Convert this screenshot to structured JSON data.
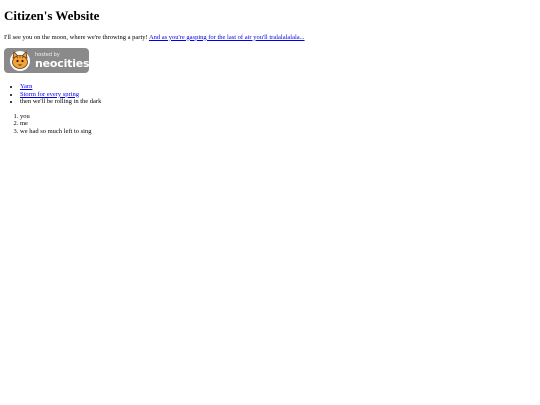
{
  "page": {
    "title": "Citizen's Website",
    "intro_text": "I'll see you on the moon, where we're throwing a party! ",
    "intro_link": "And as you're gasping for the last of air you'll tralalalalala...",
    "badge": {
      "small_text": "hosted by",
      "big_text": "neocities",
      "icon": "neocities-cat-icon"
    },
    "unordered_list": [
      "Yarn",
      "Storm for every spring",
      "then we'll be rolling in the dark"
    ],
    "ordered_list": [
      "you",
      "me",
      "we had so much left to sing"
    ]
  },
  "colors": {
    "link": "#0000ee",
    "badge_bg": "#8a8a8a"
  }
}
